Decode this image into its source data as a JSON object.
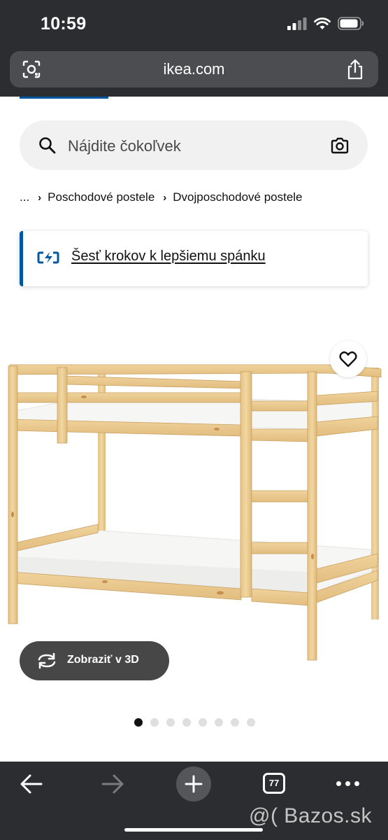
{
  "status_bar": {
    "time": "10:59"
  },
  "browser": {
    "url": "ikea.com",
    "open_tabs": "77"
  },
  "search": {
    "placeholder": "Nájdite čokoľvek"
  },
  "breadcrumb": {
    "ellipsis": "...",
    "items": [
      "Poschodové postele",
      "Dvojposchodové postele"
    ]
  },
  "promo": {
    "link_text": "Šesť krokov k lepšiemu spánku"
  },
  "product": {
    "view_3d_label": "Zobraziť v 3D",
    "image_count": 8,
    "active_image": 1
  },
  "watermark": "@( Bazos.sk",
  "colors": {
    "ikea_blue": "#0058a3",
    "browser_chrome": "#2b2d30",
    "pine_wood": "#e9c98f"
  },
  "icons": [
    "camera-lens-icon",
    "share-icon",
    "search-icon",
    "camera-icon",
    "chevron-right-icon",
    "sleep-badge-icon",
    "heart-icon",
    "rotate-3d-icon",
    "back-arrow-icon",
    "forward-arrow-icon",
    "plus-icon",
    "tabs-icon",
    "more-icon"
  ]
}
